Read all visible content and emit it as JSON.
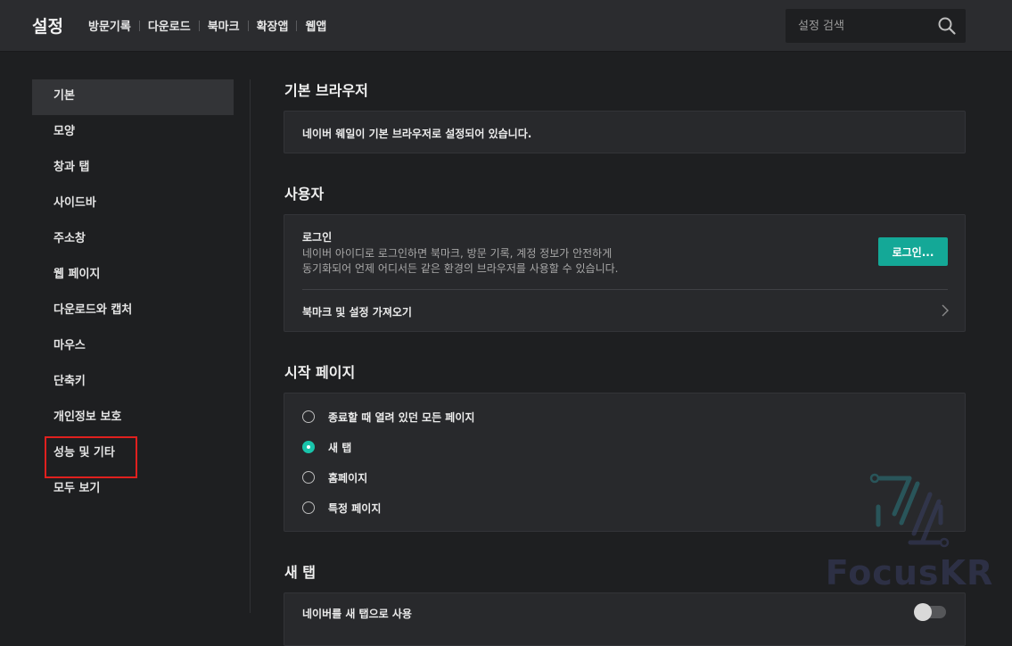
{
  "header": {
    "title": "설정",
    "nav": [
      "방문기록",
      "다운로드",
      "북마크",
      "확장앱",
      "웹앱"
    ],
    "search_placeholder": "설정 검색"
  },
  "sidebar": {
    "items": [
      "기본",
      "모양",
      "창과 탭",
      "사이드바",
      "주소창",
      "웹 페이지",
      "다운로드와 캡처",
      "마우스",
      "단축키",
      "개인정보 보호",
      "성능 및 기타",
      "모두 보기"
    ],
    "active_index": 0,
    "highlighted_index": 10
  },
  "sections": {
    "default_browser": {
      "title": "기본 브라우저",
      "status": "네이버 웨일이 기본 브라우저로 설정되어 있습니다."
    },
    "user": {
      "title": "사용자",
      "login_title": "로그인",
      "login_desc_line1": "네이버 아이디로 로그인하면 북마크, 방문 기록, 계정 정보가 안전하게",
      "login_desc_line2": "동기화되어 언제 어디서든 같은 환경의 브라우저를 사용할 수 있습니다.",
      "login_button": "로그인...",
      "import_label": "북마크 및 설정 가져오기"
    },
    "start_page": {
      "title": "시작 페이지",
      "options": [
        "종료할 때 열려 있던 모든 페이지",
        "새 탭",
        "홈페이지",
        "특정 페이지"
      ],
      "selected_index": 1
    },
    "new_tab": {
      "title": "새 탭",
      "option_label": "네이버를 새 탭으로 사용",
      "toggle_on": false
    }
  },
  "watermark": {
    "text": "FocusKR"
  },
  "colors": {
    "accent": "#14a897",
    "highlight_border": "#e0201e",
    "background": "#1e1f21",
    "card": "#28292c"
  }
}
